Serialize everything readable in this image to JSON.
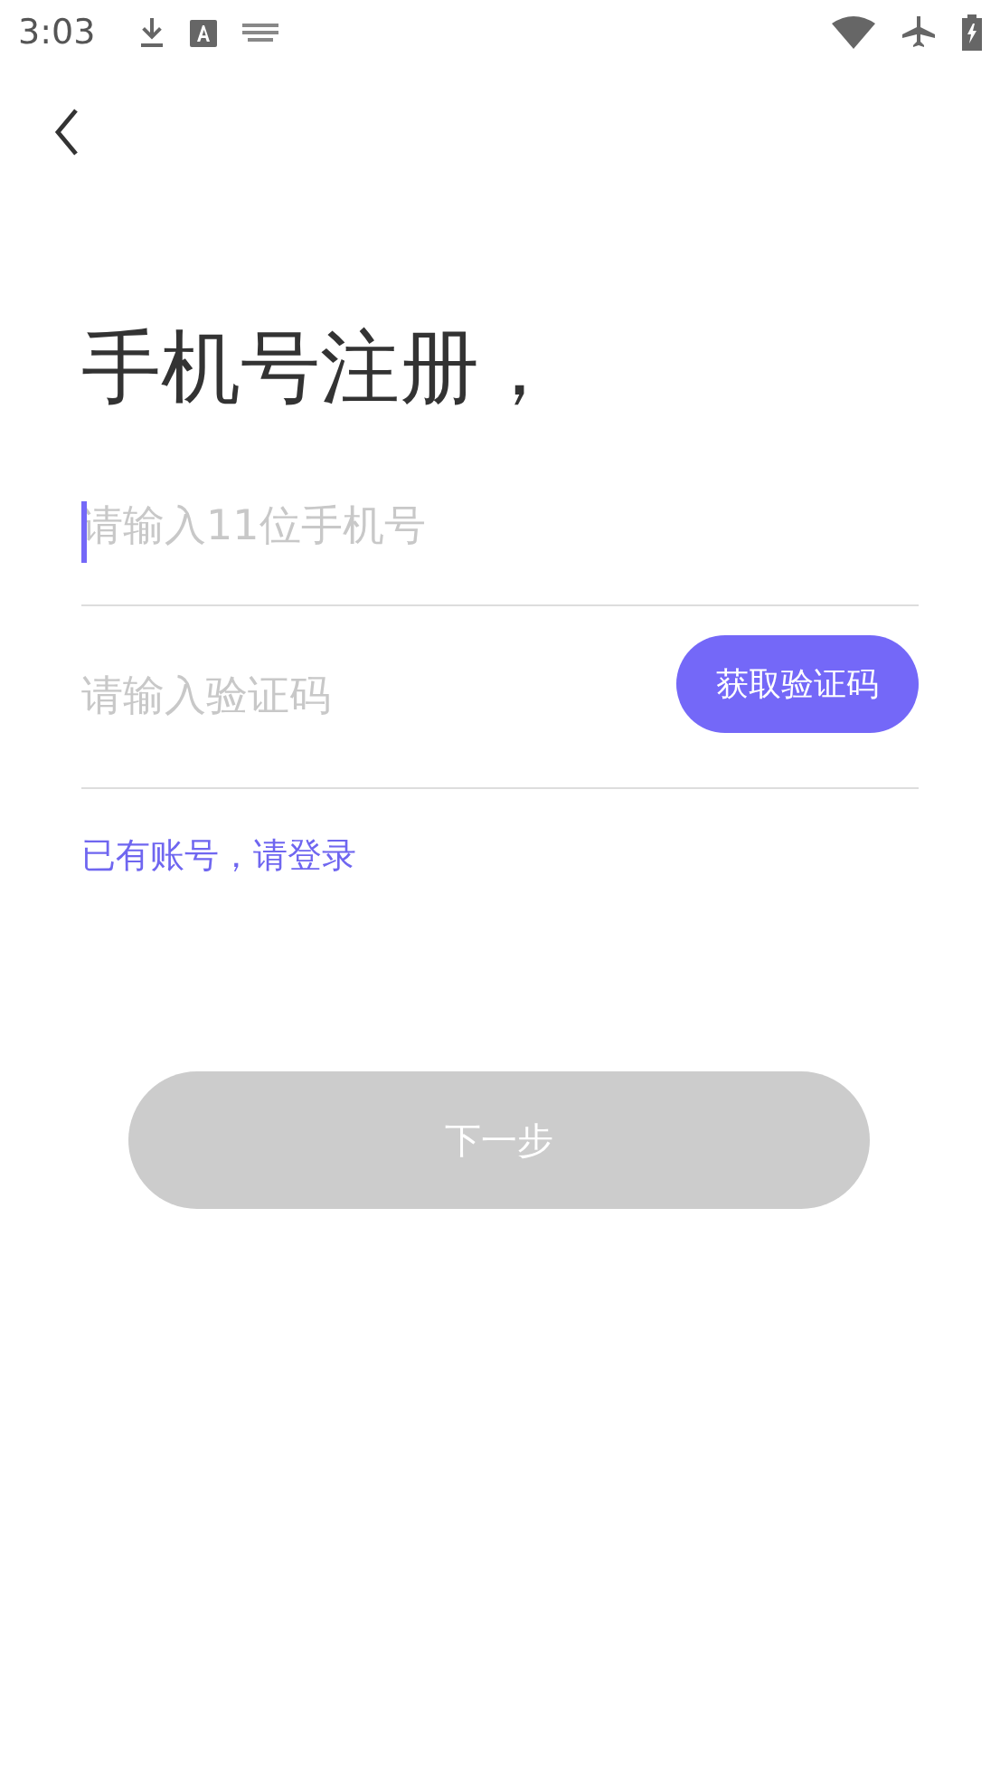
{
  "status_bar": {
    "time": "3:03"
  },
  "title": "手机号注册，",
  "fields": [
    {
      "placeholder": "请输入11位手机号",
      "focused": true
    },
    {
      "placeholder": "请输入验证码",
      "focused": false,
      "button": "获取验证码"
    }
  ],
  "login_link": "已有账号，请登录",
  "next_button": {
    "label": "下一步",
    "disabled": true
  }
}
